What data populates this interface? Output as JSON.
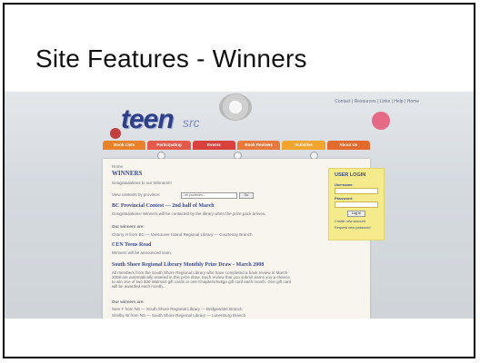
{
  "slide": {
    "title": "Site Features - Winners"
  },
  "site": {
    "top_links": "Contact | Resources | Links | Help | Home",
    "logo_main": "teen",
    "logo_sub": "src",
    "nav": [
      {
        "label": "Book Lists",
        "color": "#e8812a"
      },
      {
        "label": "Participating",
        "color": "#e35a4a"
      },
      {
        "label": "Events",
        "color": "#d9423c"
      },
      {
        "label": "Book Reviews",
        "color": "#e9793b"
      },
      {
        "label": "Activities",
        "color": "#f1a52f"
      },
      {
        "label": "About Us",
        "color": "#e26a2c"
      }
    ],
    "breadcrumb": "Home",
    "page_heading": "WINNERS",
    "congrats": "Congratulations to our Winners!!!",
    "filter_label": "View contests by province:",
    "filter_value": "-- all provinces --",
    "go_label": "Go",
    "sections": [
      {
        "heading": "BC Provincial Contest — 2nd half of March",
        "body": "Congratulations! Winners will be contacted by the library when the prize pack arrives.",
        "sub": "Our winners are:",
        "line": "Cherry H from BC — Vancouver Island Regional Library — Courtenay Branch"
      },
      {
        "heading": "CEN Teens Read",
        "body": "Winners will be announced soon.",
        "sub": "",
        "line": ""
      },
      {
        "heading": "South Shore Regional Library Monthly Prize Draw - March 2008",
        "body": "All members from the South Shore Regional Library who have completed a book review in March 2008 are automatically entered in this prize draw. Each review that you submit earns you a chance to win one of two $30 Walmart gift cards or one Chapters/Indigo gift card each month. One gift card will be awarded each month...",
        "sub": "Our winners are:",
        "line": "Sam F from NS — South Shore Regional Library — Bridgewater Branch",
        "line2": "Shelby W from NS — South Shore Regional Library — Lunenburg Branch"
      }
    ],
    "login": {
      "title": "USER LOGIN",
      "username_label": "Username:",
      "password_label": "Password:",
      "button": "Log in",
      "link1": "Create new account",
      "link2": "Request new password"
    }
  }
}
